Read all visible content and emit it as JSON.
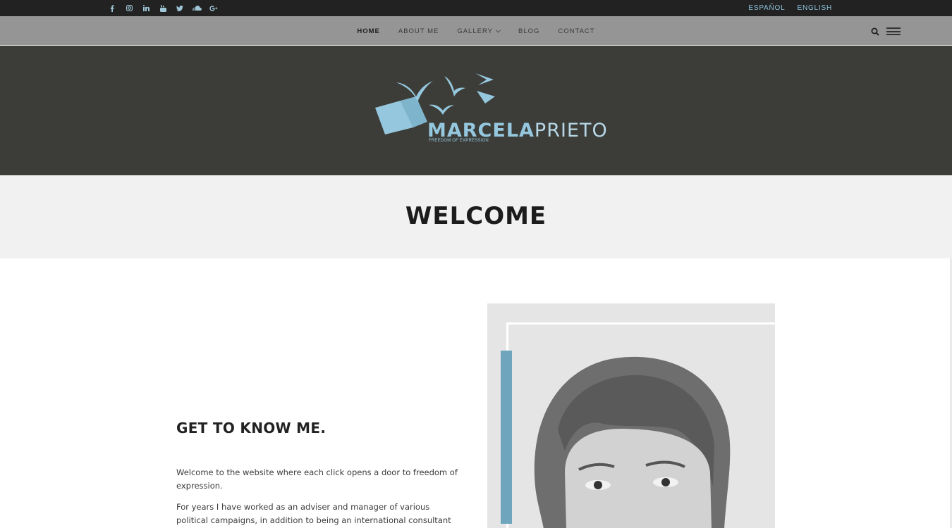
{
  "social": {
    "icons": [
      "facebook-icon",
      "instagram-icon",
      "linkedin-icon",
      "youtube-icon",
      "twitter-icon",
      "soundcloud-icon",
      "google-plus-icon"
    ]
  },
  "languages": {
    "es": "ESPAÑOL",
    "en": "ENGLISH"
  },
  "nav": {
    "items": [
      {
        "label": "HOME",
        "active": true
      },
      {
        "label": "ABOUT ME"
      },
      {
        "label": "GALLERY",
        "has_dropdown": true
      },
      {
        "label": "BLOG"
      },
      {
        "label": "CONTACT"
      }
    ],
    "right_icons": [
      "search-icon",
      "menu-icon"
    ]
  },
  "logo": {
    "name_bold": "MARCELA",
    "name_light": "PRIETO",
    "tagline": "FREEDOM OF EXPRESSION"
  },
  "welcome": {
    "title": "WELCOME"
  },
  "intro": {
    "title": "GET TO KNOW ME.",
    "paragraph_1": "Welcome to the website where each click opens a door to freedom of expression.",
    "paragraph_2": "For years I have worked as an adviser and manager of various political campaigns, in addition to being an international consultant in institutions"
  },
  "colors": {
    "topbar": "#222222",
    "nav": "#959595",
    "hero": "#3c3d38",
    "accent": "#95c8de",
    "welcome_band": "#f1f1f1",
    "photo_bar": "#6fa6bd"
  }
}
